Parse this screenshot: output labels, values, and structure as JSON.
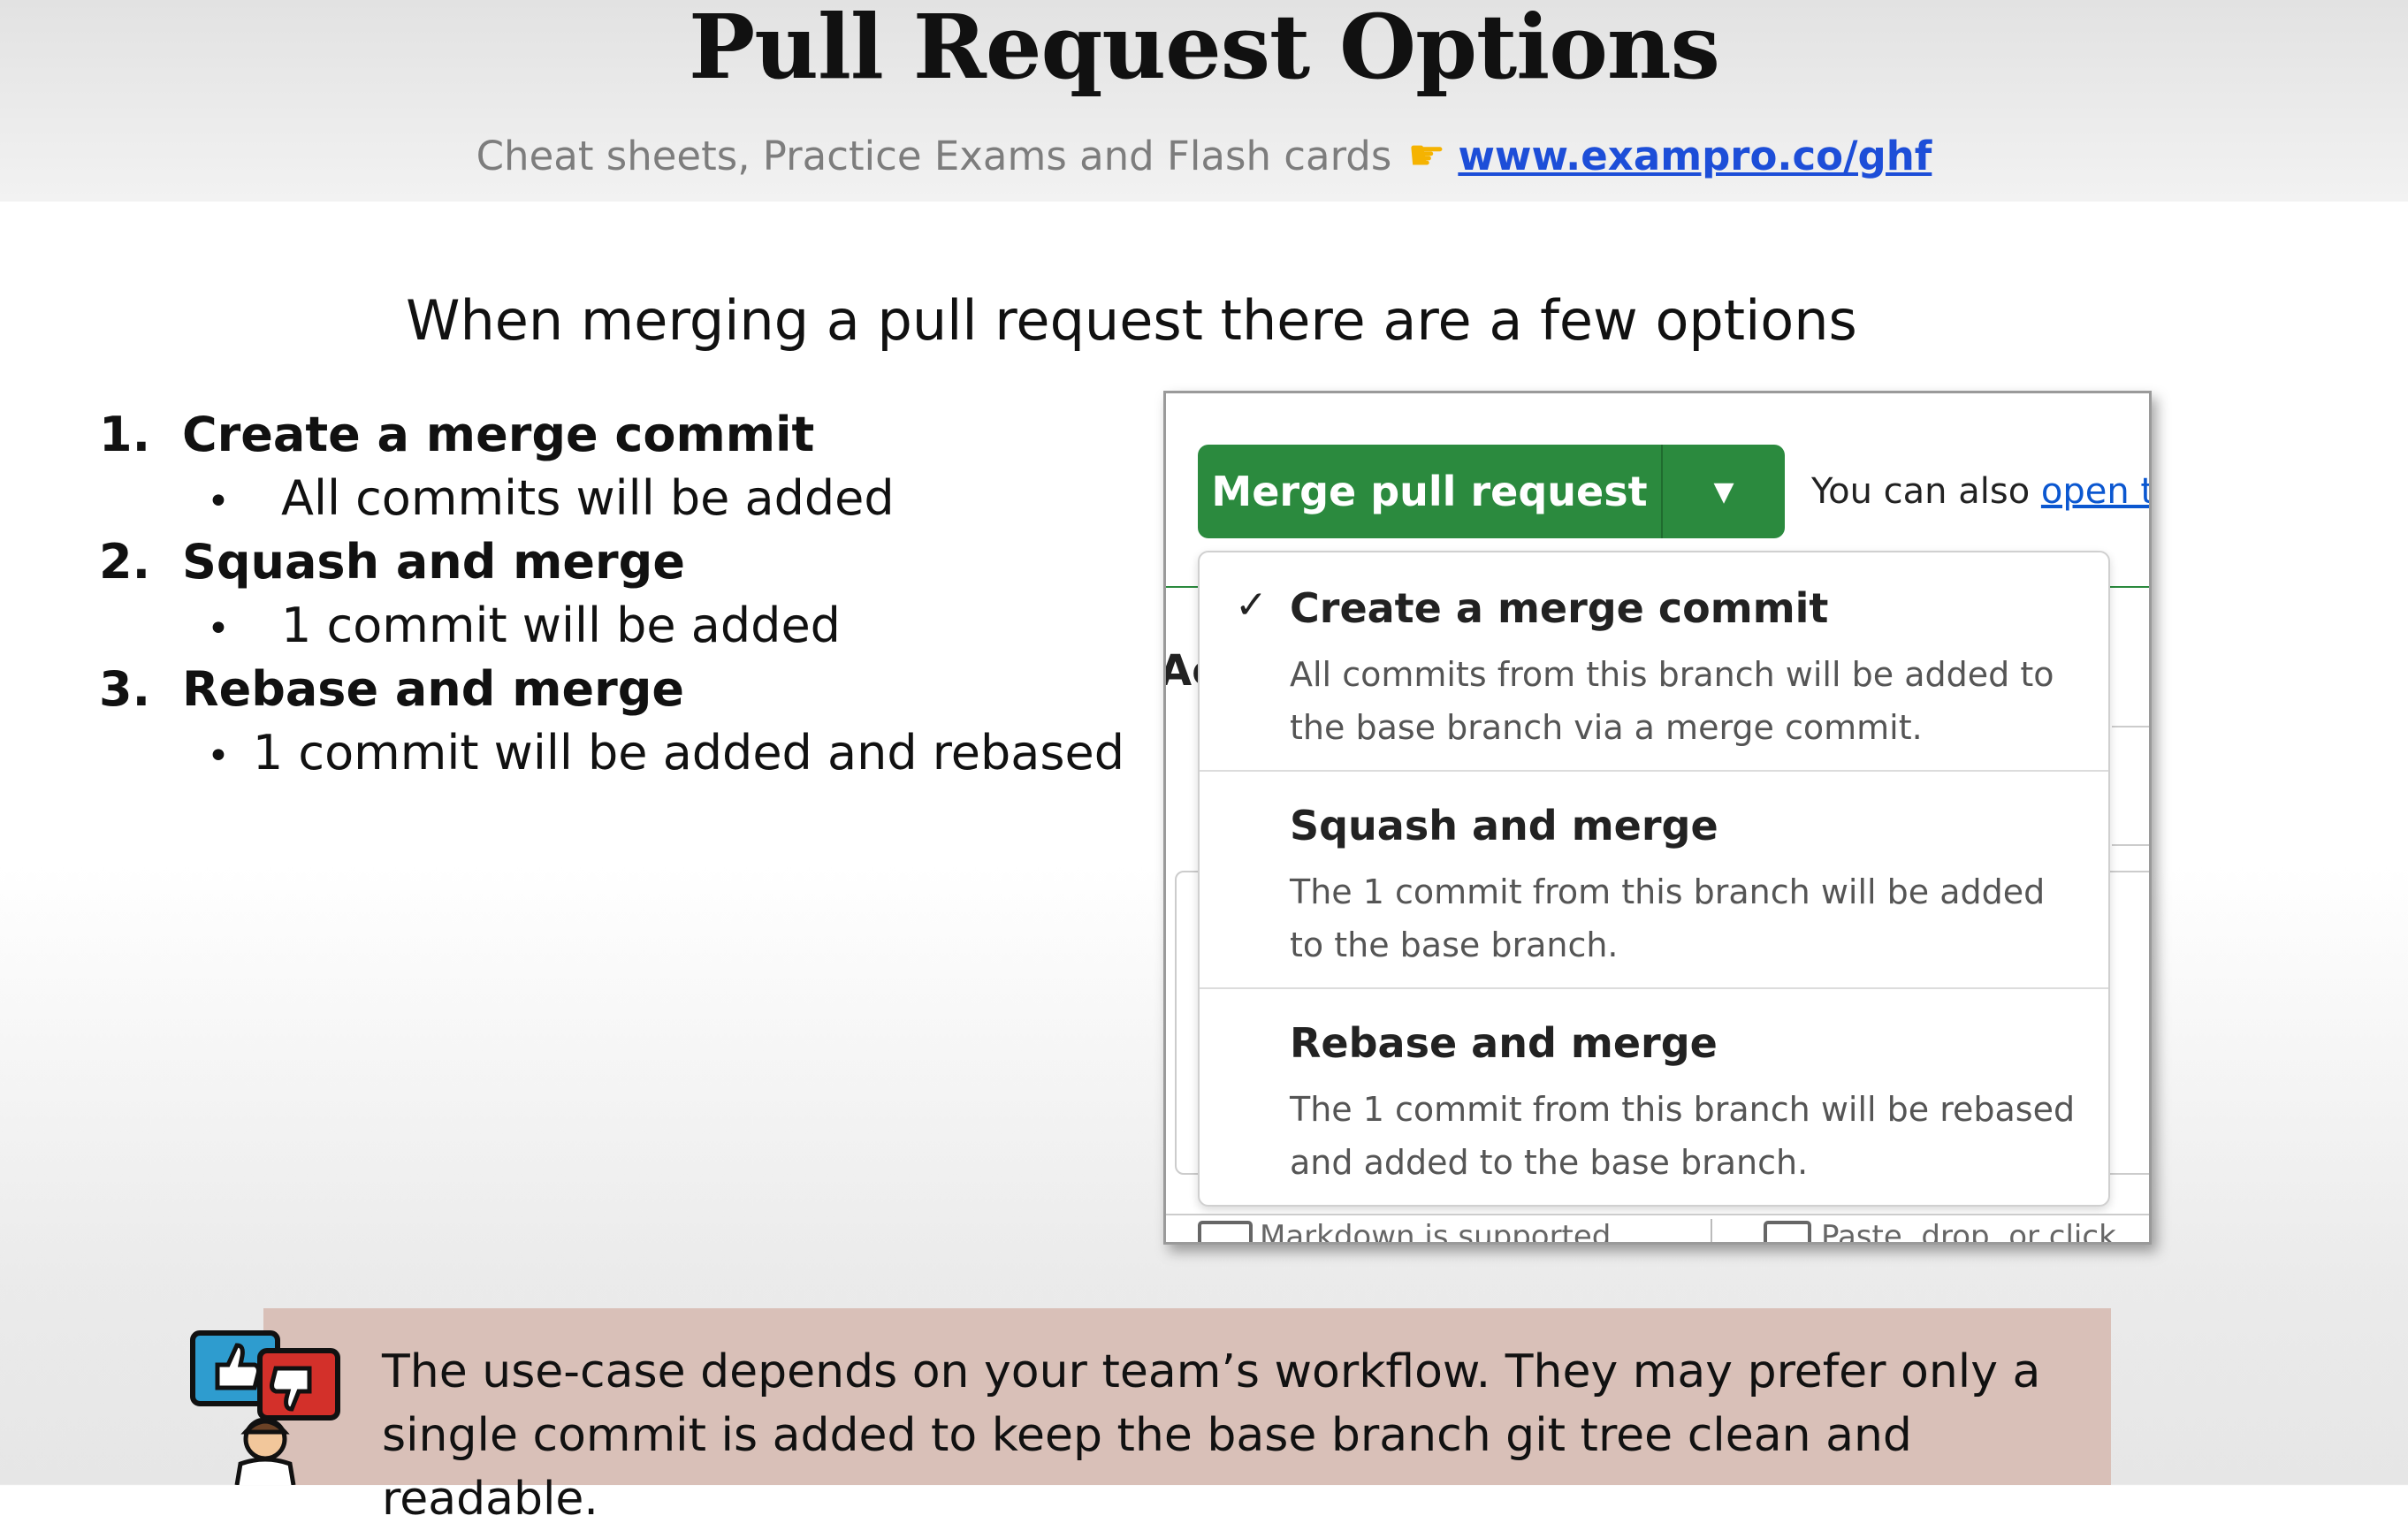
{
  "header": {
    "title": "Pull Request Options",
    "subtitle": "Cheat sheets, Practice Exams and Flash cards",
    "pointer_icon": "pointing-right-hand-icon",
    "link": "www.exampro.co/ghf"
  },
  "intro": "When merging a pull request there are a few options",
  "options": [
    {
      "number": "1.",
      "title": "Create a merge commit",
      "bullet": "All commits will be added"
    },
    {
      "number": "2.",
      "title": "Squash and merge",
      "bullet": "1 commit will be added"
    },
    {
      "number": "3.",
      "title": "Rebase and merge",
      "bullet": "1 commit will be added and rebased"
    }
  ],
  "bullet_char": "•",
  "screenshot": {
    "merge_button": "Merge pull request",
    "also_text": "You can also ",
    "also_link": "open th",
    "bg_fragment": "Ac",
    "dropdown": [
      {
        "selected": true,
        "title": "Create a merge commit",
        "desc": "All commits from this branch will be added to the base branch via a merge commit."
      },
      {
        "selected": false,
        "title": "Squash and merge",
        "desc": "The 1 commit from this branch will be added to the base branch."
      },
      {
        "selected": false,
        "title": "Rebase and merge",
        "desc": "The 1 commit from this branch will be rebased and added to the base branch."
      }
    ],
    "footer_markdown": "Markdown is supported",
    "footer_paste": "Paste, drop, or click"
  },
  "note": "The use-case depends on your team’s workflow. They may prefer only a single commit is added to keep the base branch git tree clean and readable.",
  "colors": {
    "merge_green": "#2b8a3e",
    "link_blue": "#1d4ed8",
    "note_background": "#d9c0b8"
  }
}
